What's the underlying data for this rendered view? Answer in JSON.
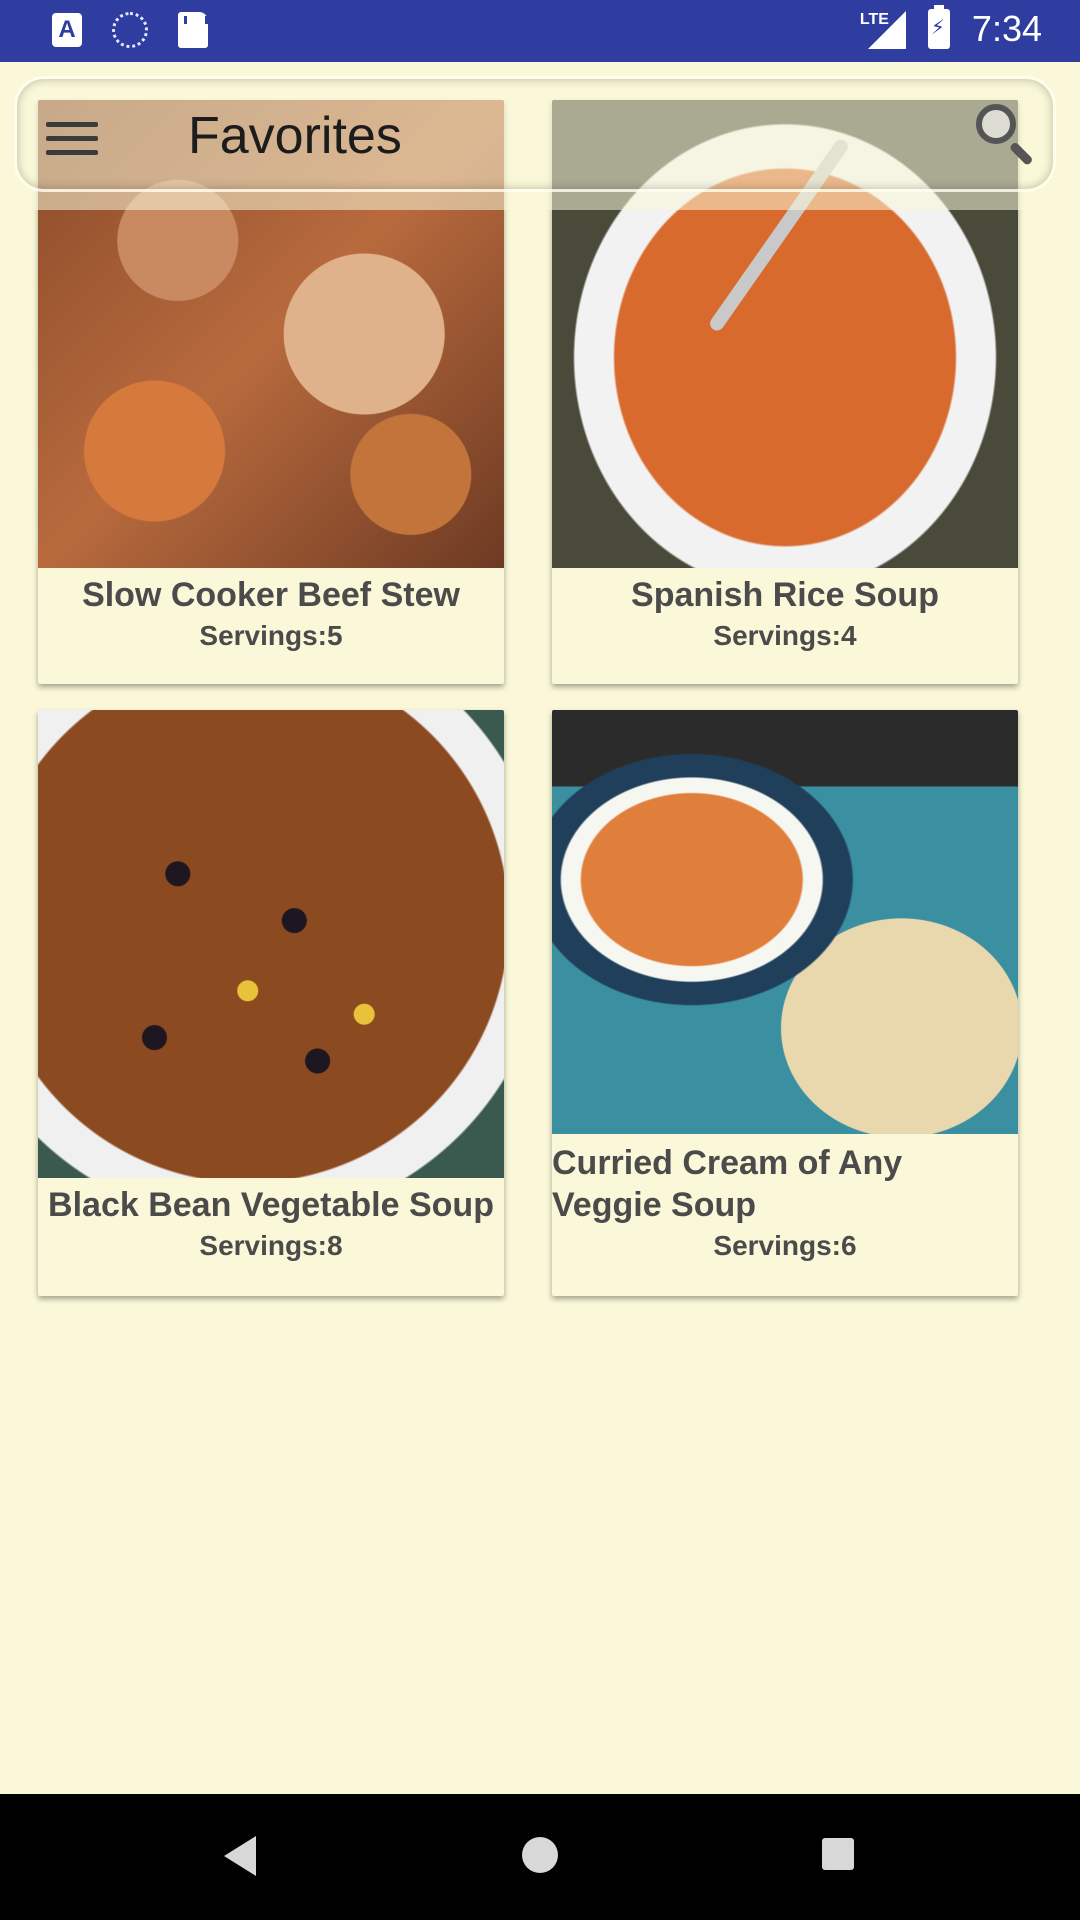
{
  "status_bar": {
    "network": "LTE",
    "time": "7:34",
    "left_icons": [
      "text-a-icon",
      "sync-circle-icon",
      "sd-card-icon"
    ]
  },
  "toolbar": {
    "title": "Favorites",
    "menu_icon": "hamburger-menu-icon",
    "search_icon": "search-icon"
  },
  "recipes": [
    {
      "title": "Slow Cooker Beef Stew",
      "servings": "Servings:5",
      "image": "beef-stew-photo"
    },
    {
      "title": "Spanish Rice Soup",
      "servings": "Servings:4",
      "image": "spanish-rice-soup-photo"
    },
    {
      "title": "Black Bean Vegetable Soup",
      "servings": "Servings:8",
      "image": "black-bean-soup-photo"
    },
    {
      "title": "Curried Cream of Any Veggie Soup",
      "servings": "Servings:6",
      "image": "curried-soup-photo"
    }
  ],
  "colors": {
    "status_bar": "#2f3da0",
    "background": "#faf8d8",
    "text": "#4b4b4b"
  },
  "nav_bar": {
    "buttons": [
      "back-icon",
      "home-icon",
      "recents-icon"
    ]
  }
}
